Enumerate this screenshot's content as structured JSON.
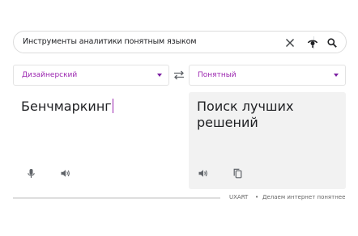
{
  "search": {
    "query": "Инструменты аналитики понятным языком"
  },
  "source_lang": {
    "label": "Дизайнерский"
  },
  "target_lang": {
    "label": "Понятный"
  },
  "source_text": "Бенчмаркинг",
  "target_text": "Поиск лучших решений",
  "footer": {
    "brand": "UXART",
    "separator": "•",
    "tagline": "Делаем интернет понятнее"
  },
  "icons": {
    "clear": "close-icon",
    "lens": "lens-icon",
    "search": "search-icon",
    "swap": "swap-icon",
    "mic": "mic-icon",
    "speaker": "speaker-icon",
    "copy": "copy-icon"
  },
  "colors": {
    "accent": "#9c27b0",
    "panel": "#f2f2f2"
  }
}
